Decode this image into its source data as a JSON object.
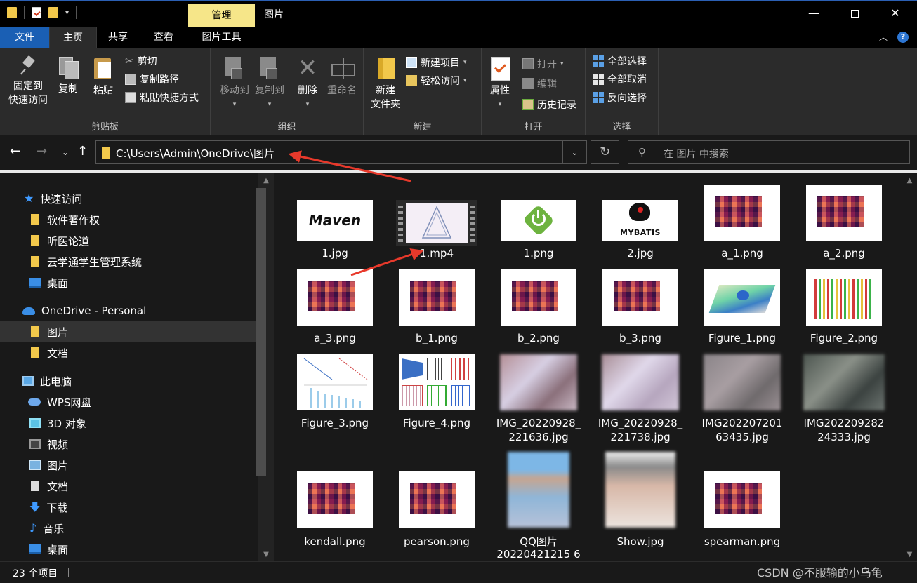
{
  "window": {
    "title": "图片",
    "context_tab": "管理",
    "controls": {
      "minimize": "—",
      "close": "✕"
    }
  },
  "menu_tabs": [
    "文件",
    "主页",
    "共享",
    "查看",
    "图片工具"
  ],
  "ribbon": {
    "clipboard": {
      "label": "剪贴板",
      "pin_line1": "固定到",
      "pin_line2": "快速访问",
      "copy": "复制",
      "paste": "粘贴",
      "cut": "剪切",
      "copy_path": "复制路径",
      "paste_shortcut": "粘贴快捷方式"
    },
    "organize": {
      "label": "组织",
      "move_to": "移动到",
      "copy_to": "复制到",
      "delete": "删除",
      "rename": "重命名"
    },
    "new": {
      "label": "新建",
      "new_folder_line1": "新建",
      "new_folder_line2": "文件夹",
      "new_item": "新建项目",
      "easy_access": "轻松访问"
    },
    "open": {
      "label": "打开",
      "properties": "属性",
      "open": "打开",
      "edit": "编辑",
      "history": "历史记录"
    },
    "select": {
      "label": "选择",
      "select_all": "全部选择",
      "select_none": "全部取消",
      "invert": "反向选择"
    }
  },
  "address": {
    "path": "C:\\Users\\Admin\\OneDrive\\图片",
    "search_placeholder": "在 图片 中搜索"
  },
  "nav": {
    "quick_access": "快速访问",
    "qa_items": [
      "软件著作权",
      "听医论道",
      "云学通学生管理系统",
      "桌面"
    ],
    "onedrive": "OneDrive - Personal",
    "od_items": [
      "图片",
      "文档"
    ],
    "this_pc": "此电脑",
    "pc_items": [
      "WPS网盘",
      "3D 对象",
      "视频",
      "图片",
      "文档",
      "下载",
      "音乐",
      "桌面"
    ]
  },
  "files": [
    {
      "name": "1.jpg",
      "kind": "maven",
      "logo_text": "Maven"
    },
    {
      "name": "1.mp4",
      "kind": "video"
    },
    {
      "name": "1.png",
      "kind": "spring"
    },
    {
      "name": "2.jpg",
      "kind": "mybatis",
      "logo_text": "MYBATIS"
    },
    {
      "name": "a_1.png",
      "kind": "heatmap"
    },
    {
      "name": "a_2.png",
      "kind": "heatmap"
    },
    {
      "name": "a_3.png",
      "kind": "heatmap"
    },
    {
      "name": "b_1.png",
      "kind": "heatmap"
    },
    {
      "name": "b_2.png",
      "kind": "heatmap"
    },
    {
      "name": "b_3.png",
      "kind": "heatmap"
    },
    {
      "name": "Figure_1.png",
      "kind": "surface3d"
    },
    {
      "name": "Figure_2.png",
      "kind": "bars3d"
    },
    {
      "name": "Figure_3.png",
      "kind": "lineplots"
    },
    {
      "name": "Figure_4.png",
      "kind": "multiplot"
    },
    {
      "name_line1": "IMG_20220928_",
      "name_line2": "221636.jpg",
      "kind": "photo"
    },
    {
      "name_line1": "IMG_20220928_",
      "name_line2": "221738.jpg",
      "kind": "photo"
    },
    {
      "name_line1": "IMG202207201",
      "name_line2": "63435.jpg",
      "kind": "photo"
    },
    {
      "name_line1": "IMG202209282",
      "name_line2": "24333.jpg",
      "kind": "photo"
    },
    {
      "name": "kendall.png",
      "kind": "heatmap"
    },
    {
      "name": "pearson.png",
      "kind": "heatmap"
    },
    {
      "name_line1": "QQ图片",
      "name_line2": "20220421215 6",
      "kind": "portrait"
    },
    {
      "name": "Show.jpg",
      "kind": "portrait"
    },
    {
      "name": "spearman.png",
      "kind": "heatmap"
    }
  ],
  "status": {
    "count": "23 个项目",
    "watermark": "CSDN @不服输的小乌龟"
  },
  "colors": {
    "accent": "#1a5fb4",
    "context_tab": "#f6e689",
    "annotation_arrow": "#e8392b",
    "folder": "#f2c84b"
  }
}
